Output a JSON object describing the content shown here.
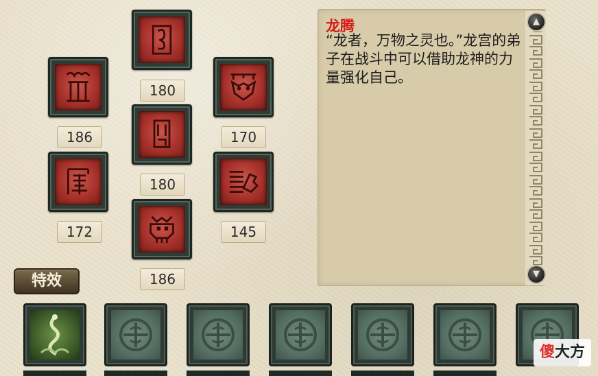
{
  "skills": [
    {
      "id": "skill-1",
      "icon": "dragon-seal-glyph-icon",
      "value": "180"
    },
    {
      "id": "skill-2",
      "icon": "ancient-script-glyph-icon",
      "value": "186"
    },
    {
      "id": "skill-3",
      "icon": "beast-mask-glyph-icon",
      "value": "170"
    },
    {
      "id": "skill-4",
      "icon": "pillar-glyph-icon",
      "value": "180"
    },
    {
      "id": "skill-5",
      "icon": "temple-glyph-icon",
      "value": "172"
    },
    {
      "id": "skill-6",
      "icon": "dragon-head-glyph-icon",
      "value": "145"
    },
    {
      "id": "skill-7",
      "icon": "demon-face-glyph-icon",
      "value": "186"
    }
  ],
  "description": {
    "title": "龙腾",
    "text": "“龙者，万物之灵也。”龙宫的弟子在战斗中可以借助龙神的力量强化自己。"
  },
  "effects_tab": {
    "label": "特效"
  },
  "effect_slots": [
    {
      "icon": "dragon-effect-icon",
      "state": "active"
    },
    {
      "icon": "locked-coin-icon",
      "state": "locked"
    },
    {
      "icon": "locked-coin-icon",
      "state": "locked"
    },
    {
      "icon": "locked-coin-icon",
      "state": "locked"
    },
    {
      "icon": "locked-coin-icon",
      "state": "locked"
    },
    {
      "icon": "locked-coin-icon",
      "state": "locked"
    },
    {
      "icon": "locked-coin-icon",
      "state": "locked"
    }
  ],
  "watermark": {
    "part1": "傻",
    "part2": "大方"
  },
  "colors": {
    "title": "#d61b14",
    "panel": "#d7cba9",
    "skill_face": "#a8322b"
  }
}
